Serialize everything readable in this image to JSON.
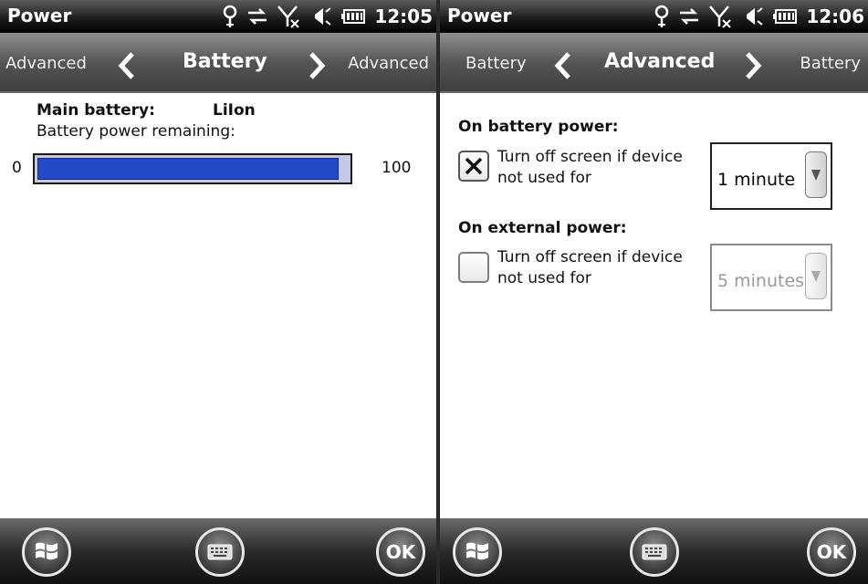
{
  "screens": [
    {
      "status": {
        "app_title": "Power",
        "time": "12:05"
      },
      "header": {
        "prev_tab": "Advanced",
        "current_tab": "Battery",
        "next_tab": "Advanced"
      },
      "battery": {
        "main_label": "Main battery:",
        "type": "LiIon",
        "remaining_label": "Battery power remaining:",
        "min_label": "0",
        "max_label": "100",
        "level_fraction": 0.97
      },
      "softkeys": {
        "ok_label": "OK"
      }
    },
    {
      "status": {
        "app_title": "Power",
        "time": "12:06"
      },
      "header": {
        "prev_tab": "Battery",
        "current_tab": "Advanced",
        "next_tab": "Battery"
      },
      "advanced": {
        "battery_section_label": "On battery power:",
        "battery_checkbox_line1": "Turn off screen if device",
        "battery_checkbox_line2": "not used for",
        "battery_checked": true,
        "battery_timeout": "1 minute",
        "external_section_label": "On external power:",
        "external_checkbox_line1": "Turn off screen if device",
        "external_checkbox_line2": "not used for",
        "external_checked": false,
        "external_timeout": "5 minutes"
      },
      "softkeys": {
        "ok_label": "OK"
      }
    }
  ],
  "colors": {
    "progress_fill": "#2349c5",
    "progress_track": "#c8c8e6",
    "bar_dark": "#000000"
  },
  "icons": [
    "antenna-icon",
    "sync-icon",
    "no-signal-icon",
    "speaker-icon",
    "battery-icon",
    "windows-start-icon",
    "keyboard-icon"
  ]
}
